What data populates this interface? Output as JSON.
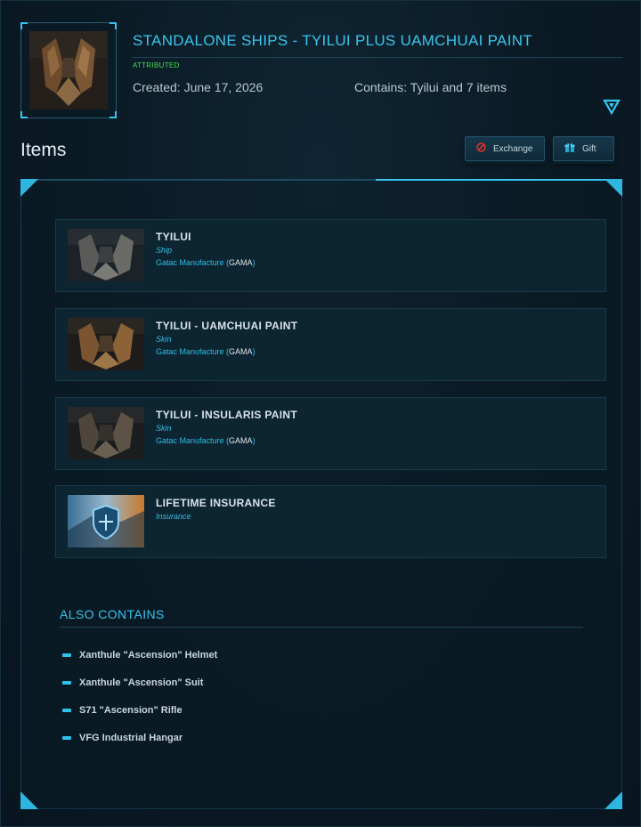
{
  "header": {
    "title": "STANDALONE SHIPS - TYILUI PLUS UAMCHUAI PAINT",
    "status": "ATTRIBUTED",
    "created": "Created: June 17, 2026",
    "contains": "Contains: Tyilui and 7 items"
  },
  "items_section": {
    "heading": "Items",
    "exchange_label": "Exchange",
    "gift_label": "Gift"
  },
  "items": [
    {
      "name": "TYILUI",
      "type": "Ship",
      "maker": "Gatac Manufacture",
      "maker_code": "GAMA"
    },
    {
      "name": "TYILUI - UAMCHUAI PAINT",
      "type": "Skin",
      "maker": "Gatac Manufacture",
      "maker_code": "GAMA"
    },
    {
      "name": "TYILUI - INSULARIS PAINT",
      "type": "Skin",
      "maker": "Gatac Manufacture",
      "maker_code": "GAMA"
    },
    {
      "name": "LIFETIME INSURANCE",
      "type": "Insurance"
    }
  ],
  "also_contains": {
    "title": "ALSO CONTAINS",
    "items": [
      "Xanthule \"Ascension\" Helmet",
      "Xanthule \"Ascension\" Suit",
      "S71 \"Ascension\" Rifle",
      "VFG Industrial Hangar"
    ]
  },
  "colors": {
    "accent": "#3cc5ee",
    "status_green": "#3fe04a",
    "background": "#0a1a25"
  },
  "icons": {
    "exchange": "no-entry-icon",
    "gift": "gift-box-icon",
    "collapse": "triangle-down-icon"
  }
}
